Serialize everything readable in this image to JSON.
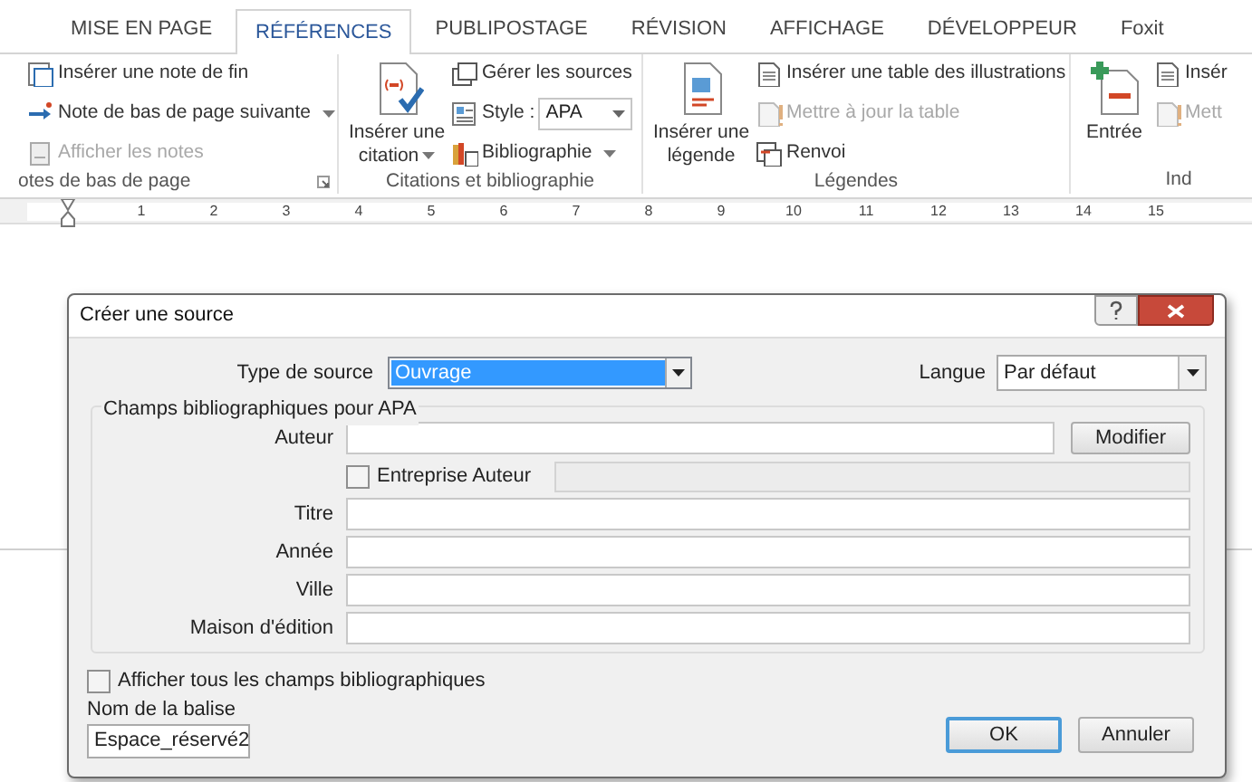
{
  "ribbon_tabs": [
    {
      "label": "MISE EN PAGE",
      "selected": false
    },
    {
      "label": "RÉFÉRENCES",
      "selected": true
    },
    {
      "label": "PUBLIPOSTAGE",
      "selected": false
    },
    {
      "label": "RÉVISION",
      "selected": false
    },
    {
      "label": "AFFICHAGE",
      "selected": false
    },
    {
      "label": "DÉVELOPPEUR",
      "selected": false
    },
    {
      "label": "Foxit",
      "selected": false
    }
  ],
  "groups": [
    {
      "label": "otes de bas de page",
      "launcher": true,
      "small": [
        {
          "kind": "button",
          "label": "Insérer une note de fin",
          "disabled": false
        },
        {
          "kind": "button",
          "label": "Note de bas de page suivante",
          "disabled": false,
          "dropdown": true
        },
        {
          "kind": "button",
          "label": "Afficher les notes",
          "disabled": true
        }
      ]
    },
    {
      "label": "Citations et bibliographie",
      "large": [
        {
          "label": "Insérer une citation",
          "dropdown": true
        }
      ],
      "small": [
        {
          "kind": "button",
          "label": "Gérer les sources",
          "disabled": false
        },
        {
          "kind": "select",
          "label": "Style :",
          "value": "APA"
        },
        {
          "kind": "button",
          "label": "Bibliographie",
          "disabled": false,
          "dropdown": true
        }
      ]
    },
    {
      "label": "Légendes",
      "large": [
        {
          "label": "Insérer une légende"
        }
      ],
      "small": [
        {
          "kind": "button",
          "label": "Insérer une table des illustrations",
          "disabled": false
        },
        {
          "kind": "button",
          "label": "Mettre à jour la table",
          "disabled": true
        },
        {
          "kind": "button",
          "label": "Renvoi",
          "disabled": false
        }
      ]
    },
    {
      "label": "Ind",
      "large": [
        {
          "label": "Entrée"
        }
      ],
      "small": [
        {
          "kind": "button",
          "label": "Insér",
          "disabled": false
        },
        {
          "kind": "button",
          "label": "Mett",
          "disabled": true
        }
      ]
    }
  ],
  "ruler_numbers": [
    "1",
    "2",
    "3",
    "4",
    "5",
    "6",
    "7",
    "8",
    "9",
    "10",
    "11",
    "12",
    "13",
    "14",
    "15"
  ],
  "dialog": {
    "title": "Créer une source",
    "source_type": {
      "label": "Type de source",
      "value": "Ouvrage"
    },
    "language": {
      "label": "Langue",
      "value": "Par défaut"
    },
    "legend": "Champs bibliographiques pour APA",
    "fields": [
      {
        "kind": "text",
        "label": "Auteur",
        "button": "Modifier"
      },
      {
        "kind": "checkbox",
        "label": "Entreprise Auteur",
        "checked": false
      },
      {
        "kind": "text",
        "label": "Titre"
      },
      {
        "kind": "text",
        "label": "Année"
      },
      {
        "kind": "text",
        "label": "Ville"
      },
      {
        "kind": "text",
        "label": "Maison d'édition"
      }
    ],
    "show_all": {
      "label": "Afficher tous les champs bibliographiques",
      "checked": false
    },
    "tag_name": {
      "label": "Nom de la balise",
      "value": "Espace_réservé2"
    },
    "buttons": [
      {
        "label": "OK",
        "default": true
      },
      {
        "label": "Annuler",
        "default": false
      }
    ]
  }
}
